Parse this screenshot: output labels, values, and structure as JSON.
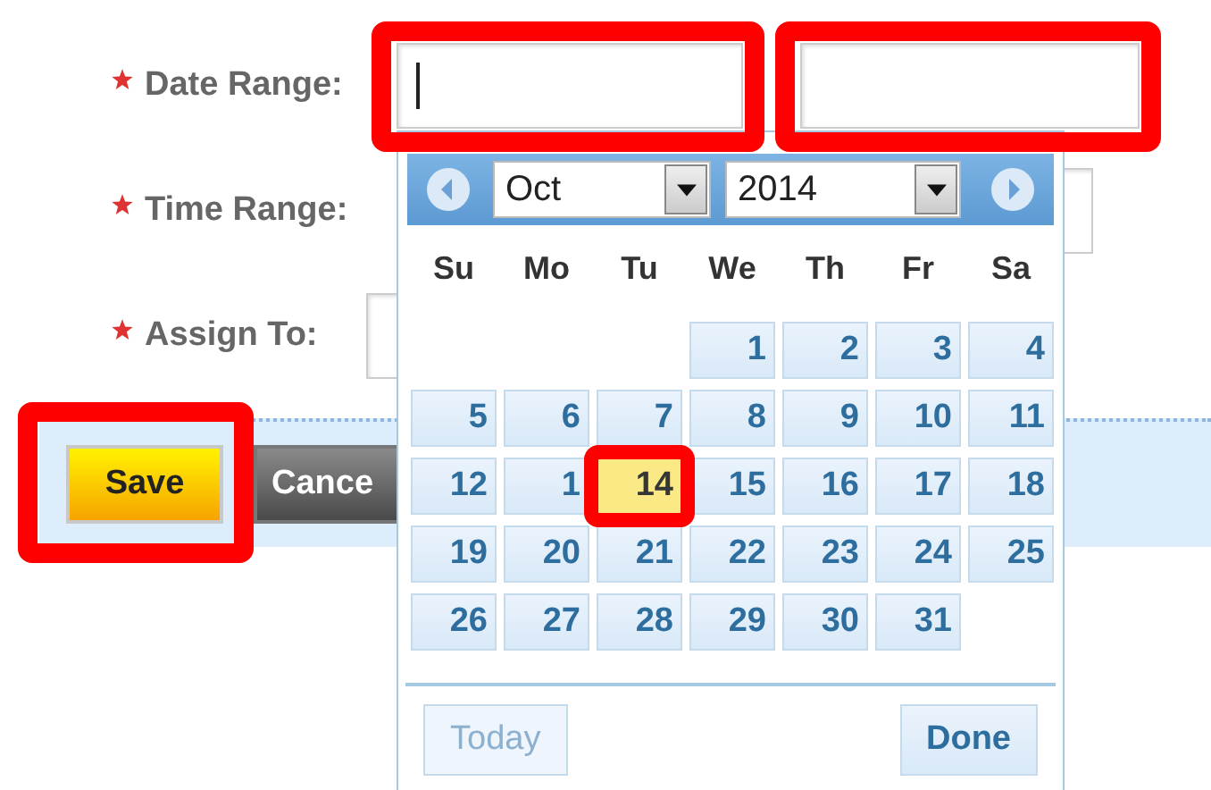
{
  "form": {
    "fields": [
      {
        "label": "Date Range:",
        "required": true,
        "inputs": [
          {
            "focused": true,
            "highlighted": true
          },
          {
            "focused": false,
            "highlighted": true
          }
        ]
      },
      {
        "label": "Time Range:",
        "required": true
      },
      {
        "label": "Assign To:",
        "required": true,
        "inputs": [
          {
            "highlighted": false
          }
        ]
      }
    ],
    "buttons": [
      {
        "label": "Save",
        "kind": "primary",
        "highlighted": true
      },
      {
        "label": "Cance",
        "kind": "secondary",
        "highlighted": false
      }
    ]
  },
  "datepicker": {
    "month": "Oct",
    "year": "2014",
    "weekdays": [
      "Su",
      "Mo",
      "Tu",
      "We",
      "Th",
      "Fr",
      "Sa"
    ],
    "weeks": [
      [
        {
          "kind": "blank"
        },
        {
          "kind": "blank"
        },
        {
          "kind": "blank"
        },
        {
          "kind": "day",
          "day": "1",
          "today": false,
          "highlighted": false
        },
        {
          "kind": "day",
          "day": "2",
          "today": false,
          "highlighted": false
        },
        {
          "kind": "day",
          "day": "3",
          "today": false,
          "highlighted": false
        },
        {
          "kind": "day",
          "day": "4",
          "today": false,
          "highlighted": false
        }
      ],
      [
        {
          "kind": "day",
          "day": "5",
          "today": false,
          "highlighted": false
        },
        {
          "kind": "day",
          "day": "6",
          "today": false,
          "highlighted": false
        },
        {
          "kind": "day",
          "day": "7",
          "today": false,
          "highlighted": false
        },
        {
          "kind": "day",
          "day": "8",
          "today": false,
          "highlighted": false
        },
        {
          "kind": "day",
          "day": "9",
          "today": false,
          "highlighted": false
        },
        {
          "kind": "day",
          "day": "10",
          "today": false,
          "highlighted": false
        },
        {
          "kind": "day",
          "day": "11",
          "today": false,
          "highlighted": false
        }
      ],
      [
        {
          "kind": "day",
          "day": "12",
          "today": false,
          "highlighted": false
        },
        {
          "kind": "day",
          "day": "1",
          "today": false,
          "highlighted": false
        },
        {
          "kind": "day",
          "day": "14",
          "today": true,
          "highlighted": true
        },
        {
          "kind": "day",
          "day": "15",
          "today": false,
          "highlighted": false
        },
        {
          "kind": "day",
          "day": "16",
          "today": false,
          "highlighted": false
        },
        {
          "kind": "day",
          "day": "17",
          "today": false,
          "highlighted": false
        },
        {
          "kind": "day",
          "day": "18",
          "today": false,
          "highlighted": false
        }
      ],
      [
        {
          "kind": "day",
          "day": "19",
          "today": false,
          "highlighted": false
        },
        {
          "kind": "day",
          "day": "20",
          "today": false,
          "highlighted": false
        },
        {
          "kind": "day",
          "day": "21",
          "today": false,
          "highlighted": false
        },
        {
          "kind": "day",
          "day": "22",
          "today": false,
          "highlighted": false
        },
        {
          "kind": "day",
          "day": "23",
          "today": false,
          "highlighted": false
        },
        {
          "kind": "day",
          "day": "24",
          "today": false,
          "highlighted": false
        },
        {
          "kind": "day",
          "day": "25",
          "today": false,
          "highlighted": false
        }
      ],
      [
        {
          "kind": "day",
          "day": "26",
          "today": false,
          "highlighted": false
        },
        {
          "kind": "day",
          "day": "27",
          "today": false,
          "highlighted": false
        },
        {
          "kind": "day",
          "day": "28",
          "today": false,
          "highlighted": false
        },
        {
          "kind": "day",
          "day": "29",
          "today": false,
          "highlighted": false
        },
        {
          "kind": "day",
          "day": "30",
          "today": false,
          "highlighted": false
        },
        {
          "kind": "day",
          "day": "31",
          "today": false,
          "highlighted": false
        },
        {
          "kind": "blank"
        }
      ]
    ],
    "buttons": [
      {
        "label": "Today",
        "disabled": true
      },
      {
        "label": "Done",
        "disabled": false
      }
    ]
  }
}
